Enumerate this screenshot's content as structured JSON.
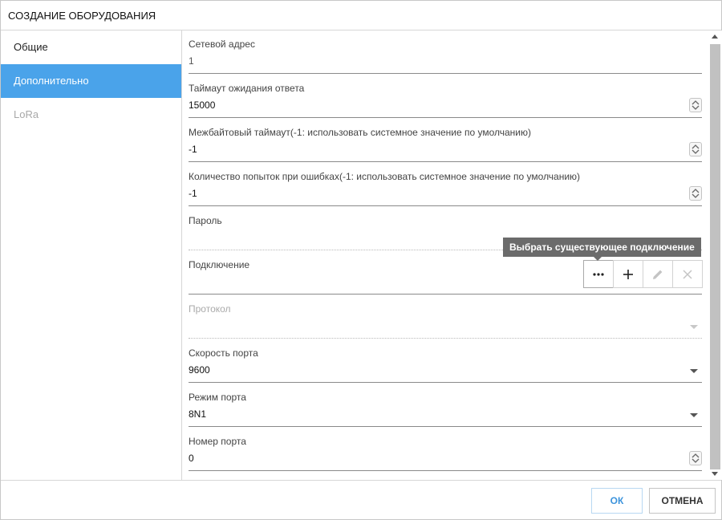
{
  "dialog": {
    "title": "СОЗДАНИЕ ОБОРУДОВАНИЯ"
  },
  "sidebar": {
    "items": [
      {
        "label": "Общие",
        "state": "normal"
      },
      {
        "label": "Дополнительно",
        "state": "active"
      },
      {
        "label": "LoRa",
        "state": "disabled"
      }
    ]
  },
  "fields": {
    "network_address": {
      "label": "Сетевой адрес",
      "value": "1"
    },
    "response_timeout": {
      "label": "Таймаут ожидания ответа",
      "value": "15000"
    },
    "interbyte_timeout": {
      "label": "Межбайтовый таймаут(-1: использовать системное значение по умолчанию)",
      "value": "-1"
    },
    "retry_count": {
      "label": "Количество попыток при ошибках(-1: использовать системное значение по умолчанию)",
      "value": "-1"
    },
    "password": {
      "label": "Пароль",
      "value": ""
    },
    "connection": {
      "label": "Подключение",
      "value": ""
    },
    "protocol": {
      "label": "Протокол",
      "value": ""
    },
    "port_speed": {
      "label": "Скорость порта",
      "value": "9600"
    },
    "port_mode": {
      "label": "Режим порта",
      "value": "8N1"
    },
    "port_number": {
      "label": "Номер порта",
      "value": "0"
    }
  },
  "connection_buttons": {
    "tooltip": "Выбрать существующее подключение",
    "icons": [
      "more-dots-icon",
      "plus-icon",
      "pencil-icon",
      "close-icon"
    ]
  },
  "footer": {
    "ok_label": "ОК",
    "cancel_label": "ОТМЕНА"
  },
  "colors": {
    "accent": "#4aa3ea",
    "tooltip_bg": "#6b6b6b",
    "ok_text": "#3b93dc"
  }
}
